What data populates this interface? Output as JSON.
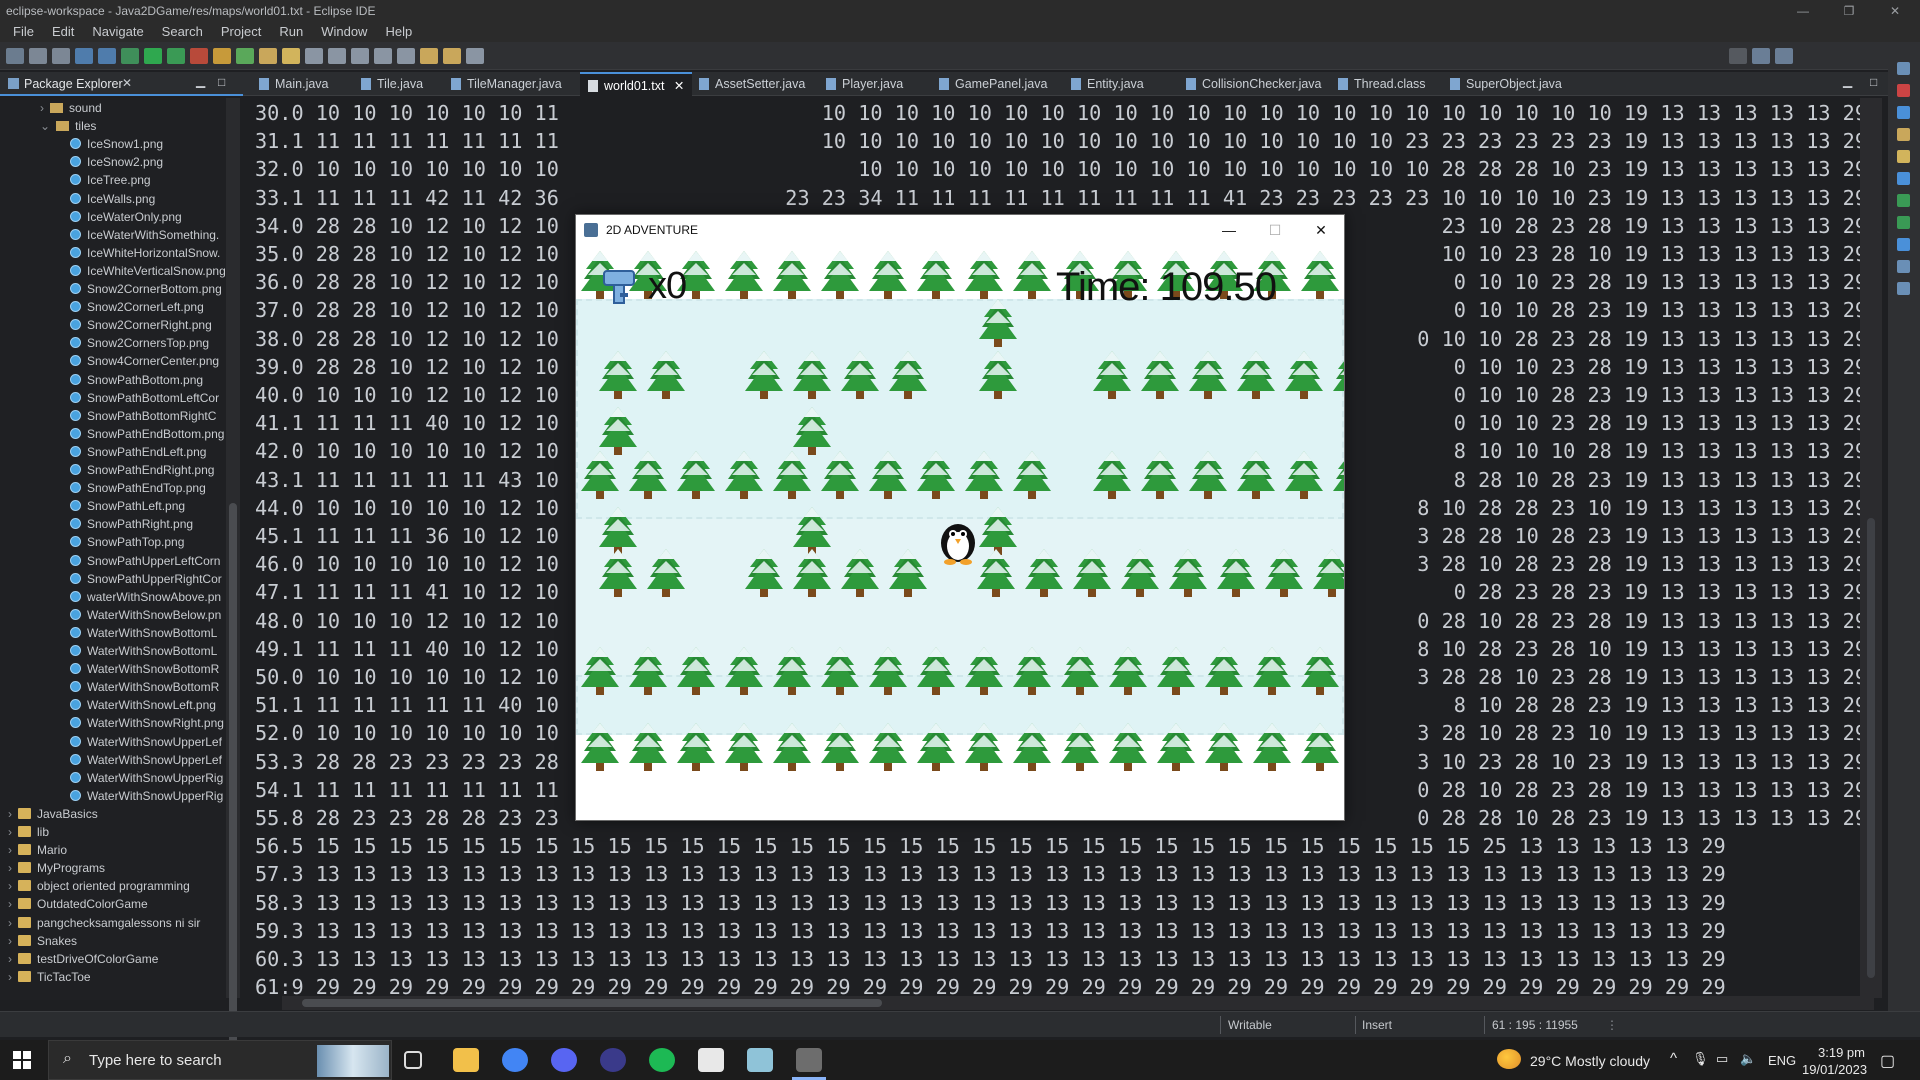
{
  "window": {
    "title": "eclipse-workspace - Java2DGame/res/maps/world01.txt - Eclipse IDE"
  },
  "menu": [
    "File",
    "Edit",
    "Navigate",
    "Search",
    "Project",
    "Run",
    "Window",
    "Help"
  ],
  "package_explorer": {
    "title": "Package Explorer",
    "folders": [
      {
        "label": "sound",
        "expanded": false
      },
      {
        "label": "tiles",
        "expanded": true
      }
    ],
    "files": [
      "IceSnow1.png",
      "IceSnow2.png",
      "IceTree.png",
      "IceWalls.png",
      "IceWaterOnly.png",
      "IceWaterWithSomething.",
      "IceWhiteHorizontalSnow.",
      "IceWhiteVerticalSnow.png",
      "Snow2CornerBottom.png",
      "Snow2CornerLeft.png",
      "Snow2CornerRight.png",
      "Snow2CornersTop.png",
      "Snow4CornerCenter.png",
      "SnowPathBottom.png",
      "SnowPathBottomLeftCor",
      "SnowPathBottomRightC",
      "SnowPathEndBottom.png",
      "SnowPathEndLeft.png",
      "SnowPathEndRight.png",
      "SnowPathEndTop.png",
      "SnowPathLeft.png",
      "SnowPathRight.png",
      "SnowPathTop.png",
      "SnowPathUpperLeftCorn",
      "SnowPathUpperRightCor",
      "waterWithSnowAbove.pn",
      "WaterWithSnowBelow.pn",
      "WaterWithSnowBottomL",
      "WaterWithSnowBottomL",
      "WaterWithSnowBottomR",
      "WaterWithSnowBottomR",
      "WaterWithSnowLeft.png",
      "WaterWithSnowRight.png",
      "WaterWithSnowUpperLef",
      "WaterWithSnowUpperLef",
      "WaterWithSnowUpperRig",
      "WaterWithSnowUpperRig"
    ],
    "projects": [
      "JavaBasics",
      "lib",
      "Mario",
      "MyPrograms",
      "object oriented programming",
      "OutdatedColorGame",
      "pangchecksamgalessons ni sir",
      "Snakes",
      "testDriveOfColorGame",
      "TicTacToe"
    ]
  },
  "editor_tabs": [
    {
      "label": "Main.java",
      "active": false
    },
    {
      "label": "Tile.java",
      "active": false
    },
    {
      "label": "TileManager.java",
      "active": false
    },
    {
      "label": "world01.txt",
      "active": true
    },
    {
      "label": "AssetSetter.java",
      "active": false
    },
    {
      "label": "Player.java",
      "active": false
    },
    {
      "label": "GamePanel.java",
      "active": false
    },
    {
      "label": "Entity.java",
      "active": false
    },
    {
      "label": "CollisionChecker.java",
      "active": false
    },
    {
      "label": "Thread.class",
      "active": false
    },
    {
      "label": "SuperObject.java",
      "active": false
    }
  ],
  "editor_lines": [
    {
      "left": "30.0 10 10 10 10 10 10 11",
      "right": "10 10 10 10 10 10 10 10 10 10 10 10 10 10 10 10 10 10 10 10 10 10 19 13 13 13 13 13 29"
    },
    {
      "left": "31.1 11 11 11 11 11 11 11",
      "right": "10 10 10 10 10 10 10 10 10 10 10 10 10 10 10 10 23 23 23 23 23 23 19 13 13 13 13 13 29"
    },
    {
      "left": "32.0 10 10 10 10 10 10 10",
      "right": "10 10 10 10 10 10 10 10 10 10 10 10 10 10 10 10 28 28 28 10 23 19 13 13 13 13 13 29"
    },
    {
      "left": "33.1 11 11 11 42 11 42 36",
      "right": "23 23 34 11 11 11 11 11 11 11 11 11 41 23 23 23 23 23 10 10 10 10 23 19 13 13 13 13 13 29"
    },
    {
      "left": "34.0 28 28 10 12 10 12 10",
      "right": "23 10 28 23 28 19 13 13 13 13 13 29"
    },
    {
      "left": "35.0 28 28 10 12 10 12 10",
      "right": "10 10 23 28 10 19 13 13 13 13 13 29"
    },
    {
      "left": "36.0 28 28 10 12 10 12 10",
      "right": "0 10 10 23 28 19 13 13 13 13 13 29"
    },
    {
      "left": "37.0 28 28 10 12 10 12 10",
      "right": "0 10 10 28 23 19 13 13 13 13 13 29"
    },
    {
      "left": "38.0 28 28 10 12 10 12 10",
      "right": "0 10 10 28 23 28 19 13 13 13 13 13 29"
    },
    {
      "left": "39.0 28 28 10 12 10 12 10",
      "right": "0 10 10 23 28 19 13 13 13 13 13 29"
    },
    {
      "left": "40.0 10 10 10 12 10 12 10",
      "right": "0 10 10 28 23 19 13 13 13 13 13 29"
    },
    {
      "left": "41.1 11 11 11 40 10 12 10",
      "right": "0 10 10 23 28 19 13 13 13 13 13 29"
    },
    {
      "left": "42.0 10 10 10 10 10 12 10",
      "right": "8 10 10 10 28 19 13 13 13 13 13 29"
    },
    {
      "left": "43.1 11 11 11 11 11 43 10",
      "right": "8 28 10 28 23 19 13 13 13 13 13 29"
    },
    {
      "left": "44.0 10 10 10 10 10 12 10",
      "right": "8 10 28 28 23 10 19 13 13 13 13 13 29"
    },
    {
      "left": "45.1 11 11 11 36 10 12 10",
      "right": "3 28 28 10 28 23 19 13 13 13 13 13 29"
    },
    {
      "left": "46.0 10 10 10 10 10 12 10",
      "right": "3 28 10 28 23 28 19 13 13 13 13 13 29"
    },
    {
      "left": "47.1 11 11 11 41 10 12 10",
      "right": "0 28 23 28 23 19 13 13 13 13 13 29"
    },
    {
      "left": "48.0 10 10 10 12 10 12 10",
      "right": "0 28 10 28 23 28 19 13 13 13 13 13 29"
    },
    {
      "left": "49.1 11 11 11 40 10 12 10",
      "right": "8 10 28 23 28 10 19 13 13 13 13 13 29"
    },
    {
      "left": "50.0 10 10 10 10 10 12 10",
      "right": "3 28 28 10 23 28 19 13 13 13 13 13 29"
    },
    {
      "left": "51.1 11 11 11 11 11 40 10",
      "right": "8 10 28 28 23 19 13 13 13 13 13 29"
    },
    {
      "left": "52.0 10 10 10 10 10 10 10",
      "right": "3 28 10 28 23 10 19 13 13 13 13 13 29"
    },
    {
      "left": "53.3 28 28 23 23 23 23 28",
      "right": "3 10 23 28 10 23 19 13 13 13 13 13 29"
    },
    {
      "left": "54.1 11 11 11 11 11 11 11",
      "right": "0 28 10 28 23 28 19 13 13 13 13 13 29"
    },
    {
      "left": "55.8 28 23 23 28 28 23 23",
      "right": "0 28 28 10 28 23 19 13 13 13 13 13 29"
    },
    {
      "full": "56.5 15 15 15 15 15 15 15 15 15 15 15 15 15 15 15 15 15 15 15 15 15 15 15 15 15 15 15 15 15 15 15 15 25 13 13 13 13 13 29"
    },
    {
      "full": "57.3 13 13 13 13 13 13 13 13 13 13 13 13 13 13 13 13 13 13 13 13 13 13 13 13 13 13 13 13 13 13 13 13 13 13 13 13 13 13 29"
    },
    {
      "full": "58.3 13 13 13 13 13 13 13 13 13 13 13 13 13 13 13 13 13 13 13 13 13 13 13 13 13 13 13 13 13 13 13 13 13 13 13 13 13 13 29"
    },
    {
      "full": "59.3 13 13 13 13 13 13 13 13 13 13 13 13 13 13 13 13 13 13 13 13 13 13 13 13 13 13 13 13 13 13 13 13 13 13 13 13 13 13 29"
    },
    {
      "full": "60.3 13 13 13 13 13 13 13 13 13 13 13 13 13 13 13 13 13 13 13 13 13 13 13 13 13 13 13 13 13 13 13 13 13 13 13 13 13 13 29"
    },
    {
      "full": "61:9 29 29 29 29 29 29 29 29 29 29 29 29 29 29 29 29 29 29 29 29 29 29 29 29 29 29 29 29 29 29 29 29 29 29 29 29 29 29 29"
    }
  ],
  "game_window": {
    "title": "2D ADVENTURE",
    "key_count": "x0",
    "time_text": "Time: 109.50"
  },
  "status_bar": {
    "mode": "Writable",
    "insert": "Insert",
    "position": "61 : 195 : 11955"
  },
  "taskbar": {
    "search_placeholder": "Type here to search",
    "weather": "29°C  Mostly cloudy",
    "language": "ENG",
    "time": "3:19 pm",
    "date": "19/01/2023"
  },
  "colors": {
    "accent": "#4a90d9",
    "editor_bg": "#1e1f22",
    "tree_green": "#2e9a3c",
    "snow": "#ffffff"
  }
}
